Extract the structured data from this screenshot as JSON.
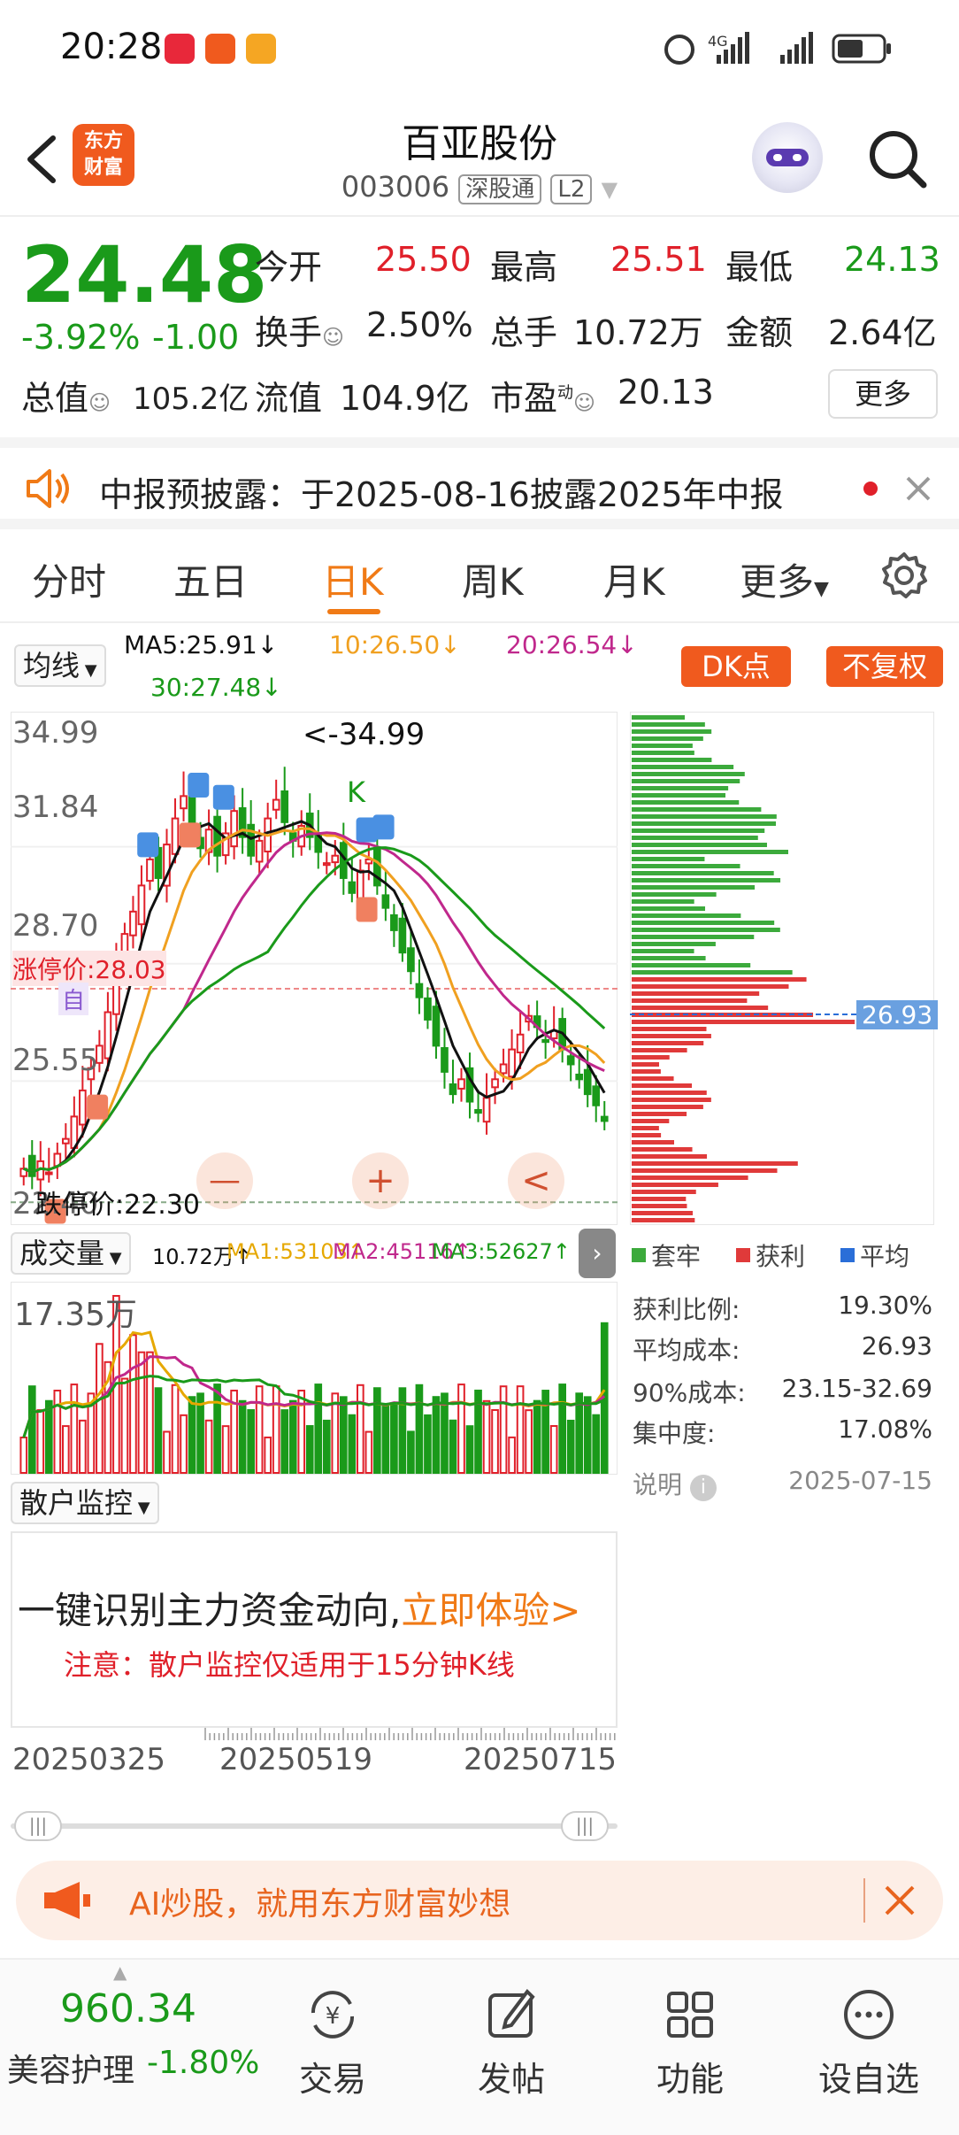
{
  "status_bar": {
    "time": "20:28",
    "network": "4G"
  },
  "header": {
    "logo_text": "东方\n财富",
    "stock_name": "百亚股份",
    "stock_code": "003006",
    "exchange_tag": "深股通",
    "level_tag": "L2"
  },
  "quote": {
    "price": "24.48",
    "change_pct": "-3.92%",
    "change_abs": "-1.00",
    "open_label": "今开",
    "open": "25.50",
    "high_label": "最高",
    "high": "25.51",
    "low_label": "最低",
    "low": "24.13",
    "turnover_label": "换手",
    "turnover": "2.50%",
    "volume_label": "总手",
    "volume": "10.72万",
    "amount_label": "金额",
    "amount": "2.64亿",
    "mktcap_label": "总值",
    "mktcap": "105.2亿",
    "float_label": "流值",
    "float": "104.9亿",
    "pe_label": "市盈",
    "pe_sup": "动",
    "pe": "20.13",
    "more_label": "更多"
  },
  "notice": {
    "text": "中报预披露：于2025-08-16披露2025年中报"
  },
  "tabs": {
    "items": [
      "分时",
      "五日",
      "日K",
      "周K",
      "月K",
      "更多"
    ],
    "active": "日K"
  },
  "kline": {
    "indicator_selector": "均线",
    "ma5": "MA5:25.91↓",
    "ma10": "10:26.50↓",
    "ma20": "20:26.54↓",
    "ma30": "30:27.48↓",
    "dk_button": "DK点",
    "fuquan_button": "不复权",
    "y_ticks": [
      "34.99",
      "31.84",
      "28.70",
      "25.55",
      "22.40"
    ],
    "max_marker": "<-34.99",
    "limit_up_label": "涨停价:28.03",
    "limit_down_label": "跌停价:22.30",
    "self_tag": "自",
    "k_tag": "K",
    "zoom_out": "—",
    "zoom_in": "+",
    "prev": "<",
    "colors": {
      "up": "#e0202a",
      "down": "#1a9a1a",
      "ma5": "#111111",
      "ma10": "#f0a020",
      "ma20": "#c0288c",
      "ma30": "#1a9a1a"
    }
  },
  "chips": {
    "avg_cost_marker": "26.93",
    "legend": [
      "套牢",
      "获利",
      "平均"
    ],
    "stats": [
      {
        "label": "获利比例:",
        "value": "19.30%"
      },
      {
        "label": "平均成本:",
        "value": "26.93"
      },
      {
        "label": "90%成本:",
        "value": "23.15-32.69"
      },
      {
        "label": "集中度:",
        "value": "17.08%"
      }
    ],
    "note_label": "说明",
    "date": "2025-07-15"
  },
  "volume_panel": {
    "selector": "成交量",
    "vol": "10.72万↑",
    "ma1": "MA1:53103↑",
    "ma2": "MA2:45116↑",
    "ma3": "MA3:52627↑",
    "y_max": "17.35万"
  },
  "retail_panel": {
    "selector": "散户监控",
    "headline": "一键识别主力资金动向,",
    "cta": "立即体验>",
    "caution": "注意：散户监控仅适用于15分钟K线"
  },
  "dates": [
    "20250325",
    "20250519",
    "20250715"
  ],
  "ad": {
    "text": "AI炒股，就用东方财富妙想"
  },
  "bottom_nav": {
    "index_value": "960.34",
    "index_name": "美容护理",
    "index_change": "-1.80%",
    "items": [
      "交易",
      "发帖",
      "功能",
      "设自选"
    ]
  }
}
